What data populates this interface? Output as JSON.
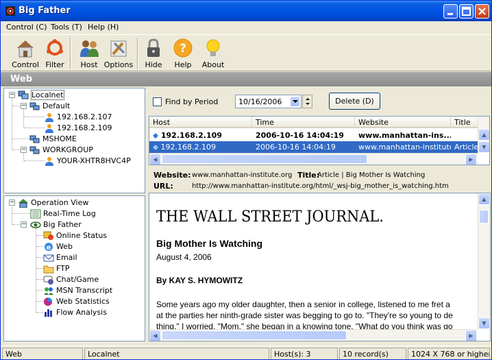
{
  "window": {
    "title": "Big Father"
  },
  "menu": [
    "Control (C)",
    "Tools (T)",
    "Help (H)"
  ],
  "toolbar": {
    "control": "Control",
    "filter": "Filter",
    "host": "Host",
    "options": "Options",
    "hide": "Hide",
    "help": "Help",
    "about": "About"
  },
  "section_title": "Web",
  "host_tree": {
    "root": "Localnet",
    "groups": [
      {
        "name": "Default",
        "children": [
          "192.168.2.107",
          "192.168.2.109"
        ]
      },
      {
        "name": "MSHOME",
        "children": []
      },
      {
        "name": "WORKGROUP",
        "children": [
          "YOUR-XHTR8HVC4P"
        ]
      }
    ]
  },
  "view_tree": {
    "root": "Operation View",
    "realtime": "Real-Time Log",
    "bigfather": "Big Father",
    "items": [
      "Online Status",
      "Web",
      "Email",
      "FTP",
      "Chat/Game",
      "MSN Transcript",
      "Web Statistics",
      "Flow Analysis"
    ]
  },
  "filter": {
    "find_by_period": "Find by Period",
    "date": "10/16/2006",
    "delete_button": "Delete (D)"
  },
  "grid": {
    "columns": [
      "Host",
      "Time",
      "Website",
      "Title"
    ],
    "rows": [
      {
        "host": "192.168.2.109",
        "time": "2006-10-16 14:04:19",
        "website": "www.manhattan-ins...",
        "title": ""
      },
      {
        "host": "192.168.2.109",
        "time": "2006-10-16 14:04:19",
        "website": "www.manhattan-institute....",
        "title": "Article |"
      }
    ]
  },
  "detail": {
    "website_label": "Website:",
    "website_value": "www.manhattan-institute.org",
    "title_label": "Title:",
    "title_value": "Article | Big Mother Is Watching",
    "url_label": "URL:",
    "url_value": "http://www.manhattan-institute.org/html/_wsj-big_mother_is_watching.htm"
  },
  "article": {
    "masthead": "THE WALL STREET JOURNAL.",
    "headline": "Big Mother Is Watching",
    "date": "August 4, 2006",
    "byline": "By KAY S. HYMOWITZ",
    "para1_line1": "Some years ago my older daughter, then a senior in college, listened to me fret a",
    "para1_line2": "at the parties her ninth-grade sister was begging to go to. \"They're so young to de",
    "para1_line3": "thing,\" I worried. \"Mom,\" she began in a knowing tone, \"What do you think was go"
  },
  "status": {
    "view": "Web",
    "network": "Localnet",
    "hosts": "Host(s): 3",
    "records": "10 record(s)",
    "resolution": "1024 X 768 or higher"
  },
  "colors": {
    "titlebar": "#0054e3",
    "selection": "#316ac5",
    "section": "#8c8c8c"
  }
}
